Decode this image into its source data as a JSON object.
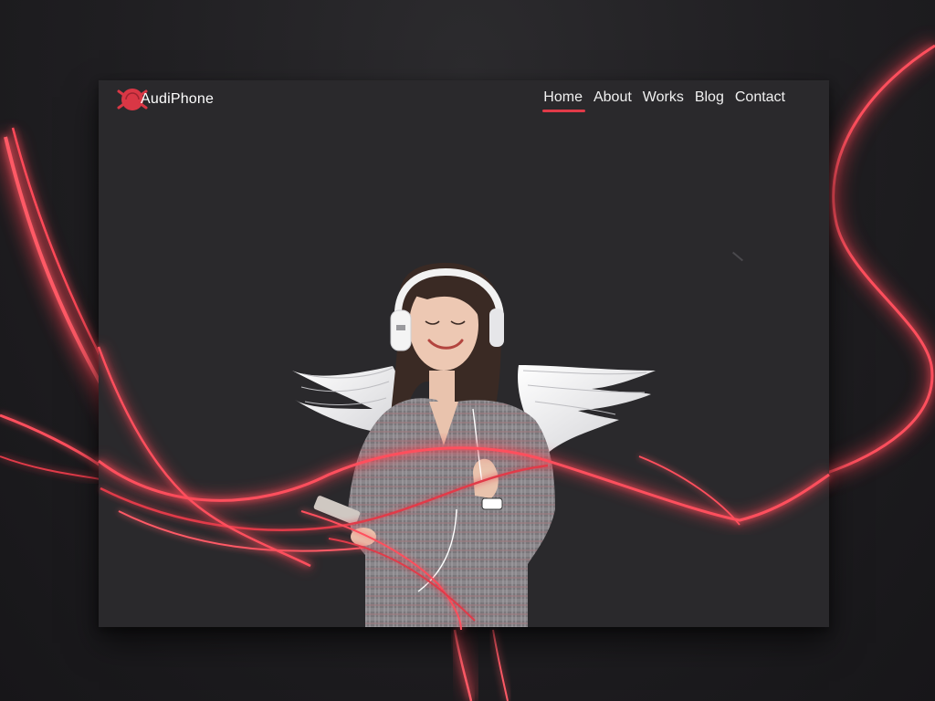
{
  "brand": {
    "name": "AudiPhone",
    "accent_color": "#e13a48",
    "logo_icon": "red-circle-logo-icon"
  },
  "nav": {
    "items": [
      {
        "label": "Home",
        "active": true
      },
      {
        "label": "About",
        "active": false
      },
      {
        "label": "Works",
        "active": false
      },
      {
        "label": "Blog",
        "active": false
      },
      {
        "label": "Contact",
        "active": false
      }
    ]
  },
  "hero": {
    "image": "woman-with-white-headphones-and-angel-wings-holding-phone",
    "decoration": "glowing-red-light-ribbons"
  },
  "colors": {
    "page_background": "#1c1b1d",
    "card_background": "#2a292c",
    "ribbon": "#e13a48",
    "text": "#ffffff"
  }
}
